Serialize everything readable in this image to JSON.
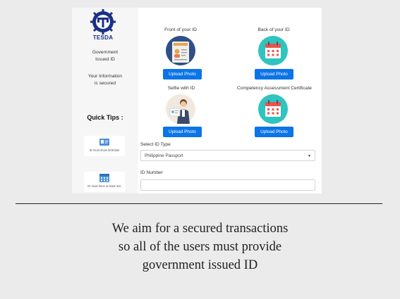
{
  "sidebar": {
    "logo_text": "TESDA",
    "gov_id_line1": "Government",
    "gov_id_line2": "Issued ID",
    "secure_line1": "Your Information",
    "secure_line2": "is secured",
    "quick_tips": "Quick Tips :",
    "tips": [
      {
        "icon": "id-card-icon",
        "caption": "ID must show birthdate"
      },
      {
        "icon": "calendar-icon",
        "caption": "ID must have at least one"
      }
    ]
  },
  "uploads": {
    "front": {
      "label": "Front of your ID",
      "button": "Upload Photo",
      "icon": "id-card-icon"
    },
    "back": {
      "label": "Back of your ID",
      "button": "Upload Photo",
      "icon": "calendar-icon"
    },
    "selfie": {
      "label": "Selfie with ID",
      "button": "Upload Photo",
      "icon": "selfie-icon"
    },
    "certificate": {
      "label": "Competency Assessment Certificate",
      "button": "Upload Photo",
      "icon": "calendar-icon"
    }
  },
  "form": {
    "select_label": "Select ID Type",
    "select_value": "Philippine Passport",
    "id_number_label": "ID Number",
    "id_number_value": ""
  },
  "caption": {
    "line1": "We aim for a secured transactions",
    "line2": "so all of the users must provide",
    "line3": "government issued ID"
  },
  "colors": {
    "button_blue": "#0b74e8",
    "teal_circle": "#2ec4c0",
    "calendar_red": "#e8554e",
    "logo_blue": "#1a2f86"
  }
}
